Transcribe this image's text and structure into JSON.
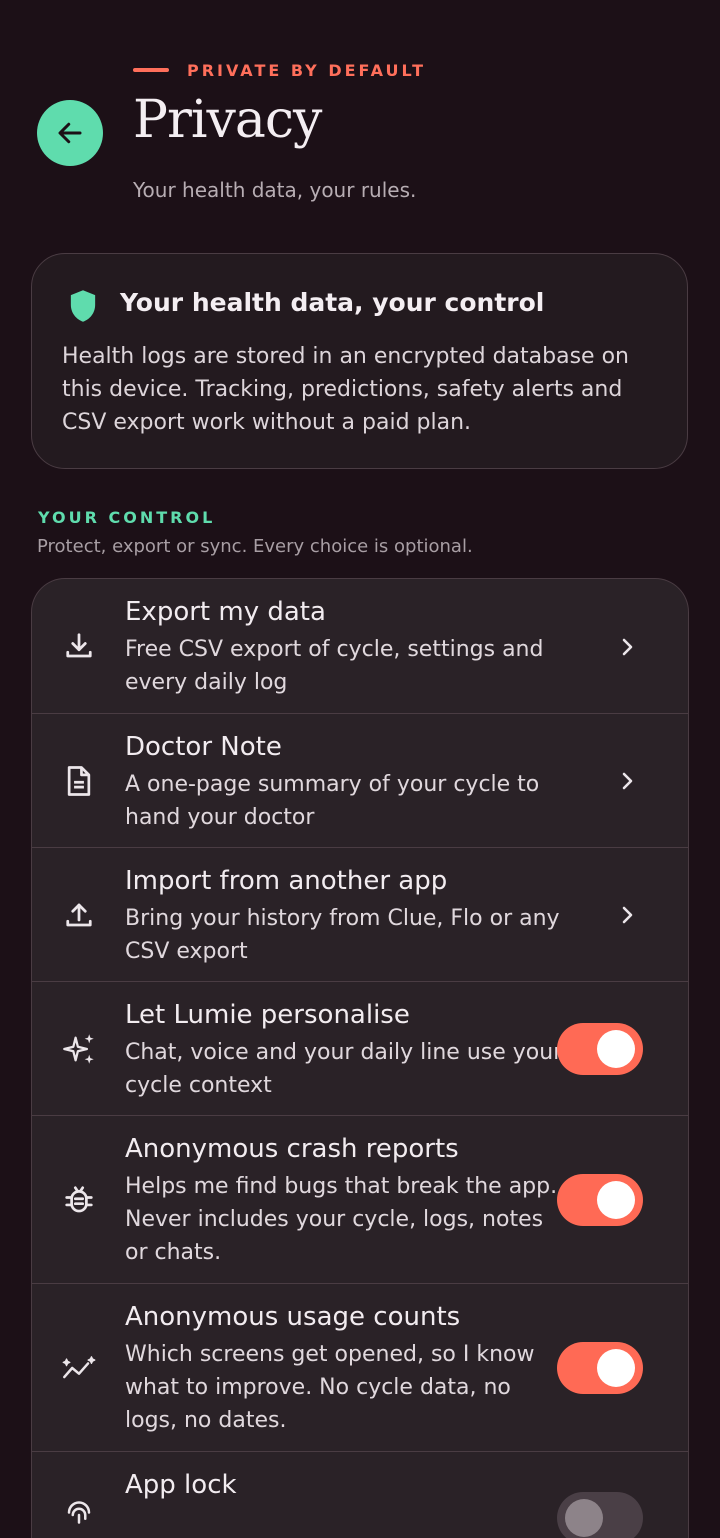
{
  "header": {
    "eyebrow": "PRIVATE BY DEFAULT",
    "title": "Privacy",
    "subtitle": "Your health data, your rules."
  },
  "info_card": {
    "title": "Your health data, your control",
    "body": "Health logs are stored in an encrypted database on this device. Tracking, predictions, safety alerts and CSV export work without a paid plan."
  },
  "section": {
    "label": "YOUR CONTROL",
    "subtitle": "Protect, export or sync. Every choice is optional."
  },
  "items": [
    {
      "icon": "download-icon",
      "title": "Export my data",
      "desc": "Free CSV export of cycle, settings and every daily log",
      "control": "chevron"
    },
    {
      "icon": "document-icon",
      "title": "Doctor Note",
      "desc": "A one-page summary of your cycle to hand your doctor",
      "control": "chevron"
    },
    {
      "icon": "upload-icon",
      "title": "Import from another app",
      "desc": "Bring your history from Clue, Flo or any CSV export",
      "control": "chevron"
    },
    {
      "icon": "sparkle-icon",
      "title": "Let Lumie personalise",
      "desc": "Chat, voice and your daily line use your cycle context",
      "control": "toggle",
      "on": true
    },
    {
      "icon": "bug-icon",
      "title": "Anonymous crash reports",
      "desc": "Helps me find bugs that break the app. Never includes your cycle, logs, notes or chats.",
      "control": "toggle",
      "on": true
    },
    {
      "icon": "analytics-icon",
      "title": "Anonymous usage counts",
      "desc": "Which screens get opened, so I know what to improve. No cycle data, no logs, no dates.",
      "control": "toggle",
      "on": true
    },
    {
      "icon": "fingerprint-icon",
      "title": "App lock",
      "desc": "",
      "control": "toggle",
      "on": false
    }
  ],
  "colors": {
    "background": "#1c1017",
    "accent_coral": "#ff6f5b",
    "accent_mint": "#5fdcad",
    "card": "#2a2227"
  }
}
